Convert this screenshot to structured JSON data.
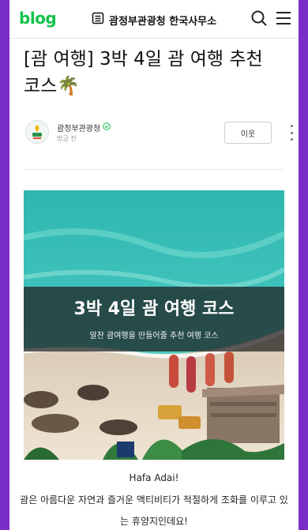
{
  "header": {
    "logo": "blog",
    "blog_name": "괌정부관광청 한국사무소"
  },
  "post": {
    "title": "[괌 여행] 3박 4일 괌 여행 추천 코스🌴",
    "author": {
      "name": "괌정부관광청",
      "time": "방금 전",
      "follow_label": "이웃"
    },
    "cover": {
      "title": "3박 4일 괌 여행 코스",
      "subtitle": "알찬 괌여행을 만들어줄 추천 여행 코스"
    },
    "greeting": "Hafa Adai!",
    "body": "괌은 아름다운 자연과 즐거운 액티비티가 적절하게 조화를 이루고 있는 휴양지인데요!"
  },
  "colors": {
    "brand_green": "#13c24a",
    "frame_purple": "#7a2cc6"
  }
}
